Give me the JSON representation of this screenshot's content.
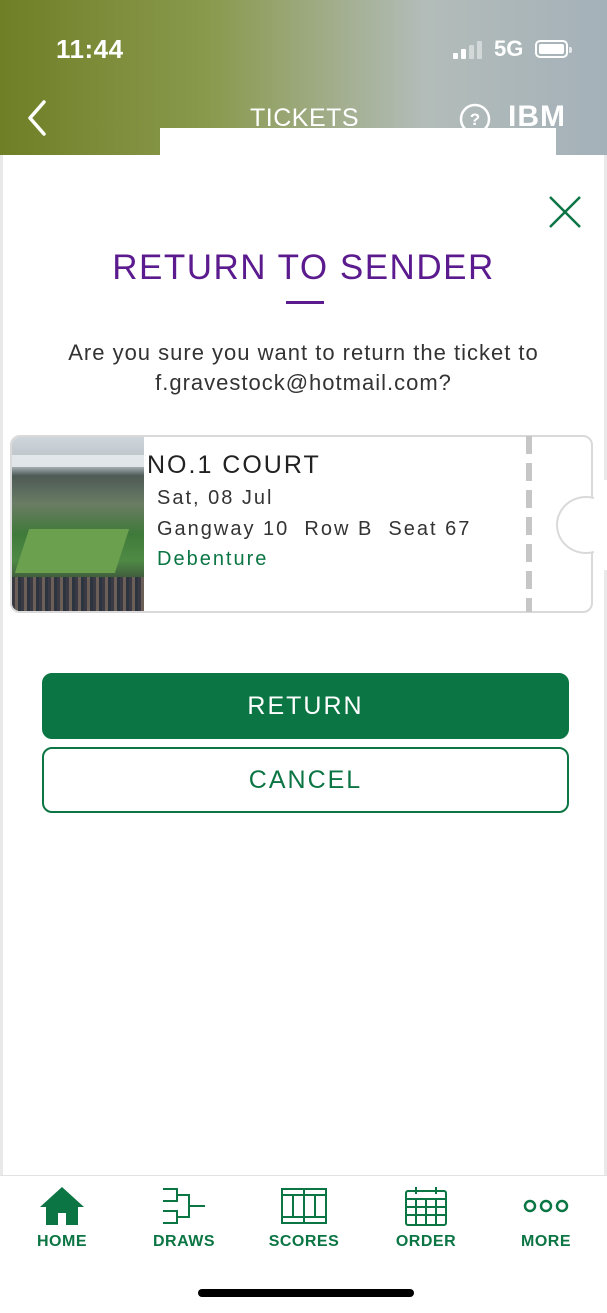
{
  "status_bar": {
    "time": "11:44",
    "network": "5G"
  },
  "header": {
    "title": "TICKETS",
    "logo": "IBM"
  },
  "dialog": {
    "title": "RETURN TO SENDER",
    "message": "Are you sure you want to return the ticket to f.gravestock@hotmail.com?"
  },
  "ticket": {
    "court": "NO.1 COURT",
    "date": "Sat, 08 Jul",
    "seat": "Gangway 10  Row B  Seat 67",
    "type": "Debenture"
  },
  "actions": {
    "return_label": "RETURN",
    "cancel_label": "CANCEL"
  },
  "tabs": [
    {
      "label": "HOME",
      "icon": "home-icon"
    },
    {
      "label": "DRAWS",
      "icon": "draws-icon"
    },
    {
      "label": "SCORES",
      "icon": "scores-icon"
    },
    {
      "label": "ORDER",
      "icon": "calendar-icon"
    },
    {
      "label": "MORE",
      "icon": "more-icon"
    }
  ],
  "colors": {
    "accent_green": "#0b7544",
    "title_purple": "#5b1b8e"
  }
}
